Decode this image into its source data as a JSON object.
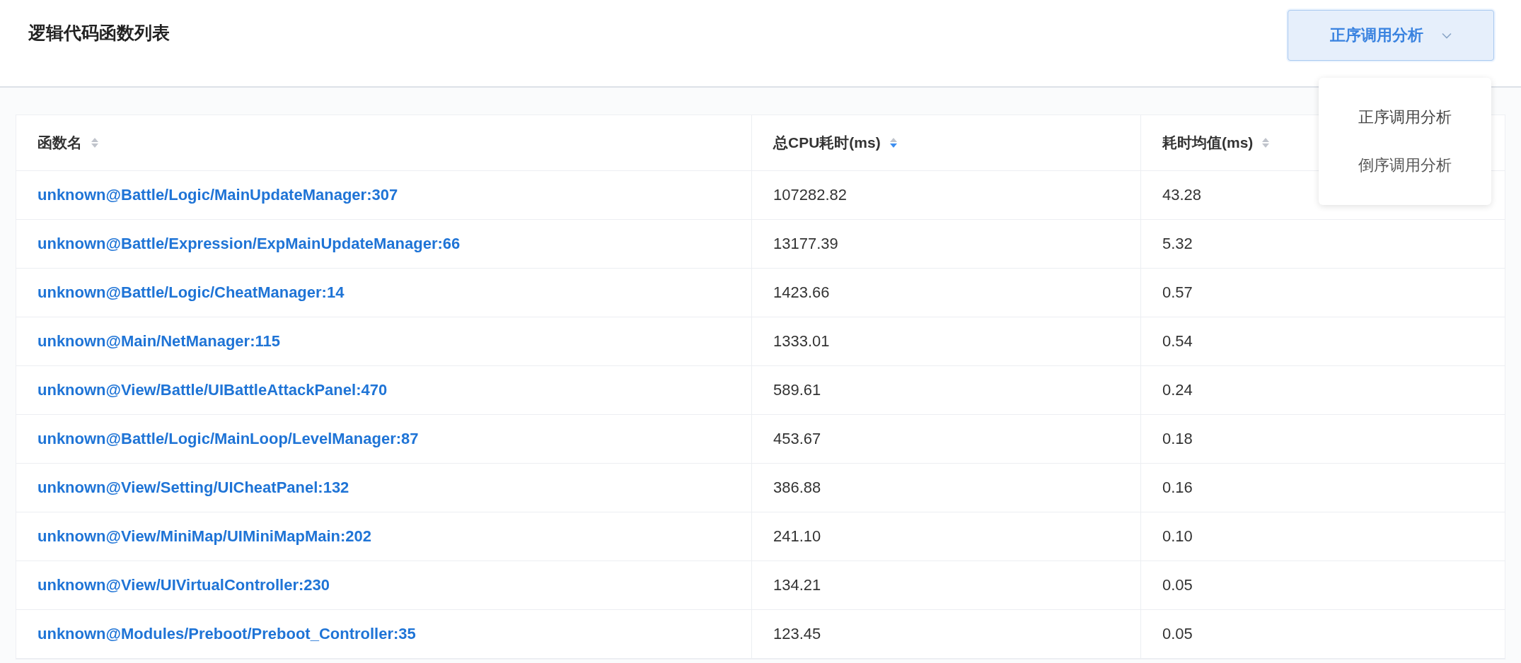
{
  "header": {
    "title": "逻辑代码函数列表",
    "dropdown": {
      "value": "正序调用分析",
      "expanded": true,
      "options": [
        {
          "label": "正序调用分析",
          "selected": true
        },
        {
          "label": "倒序调用分析",
          "selected": false
        }
      ]
    }
  },
  "table": {
    "columns": [
      {
        "label": "函数名",
        "sorted_descending": false
      },
      {
        "label": "总CPU耗时(ms)",
        "sorted_descending": true
      },
      {
        "label": "耗时均值(ms)",
        "sorted_descending": false
      }
    ],
    "rows": [
      [
        "unknown@Battle/Logic/MainUpdateManager:307",
        "107282.82",
        "43.28"
      ],
      [
        "unknown@Battle/Expression/ExpMainUpdateManager:66",
        "13177.39",
        "5.32"
      ],
      [
        "unknown@Battle/Logic/CheatManager:14",
        "1423.66",
        "0.57"
      ],
      [
        "unknown@Main/NetManager:115",
        "1333.01",
        "0.54"
      ],
      [
        "unknown@View/Battle/UIBattleAttackPanel:470",
        "589.61",
        "0.24"
      ],
      [
        "unknown@Battle/Logic/MainLoop/LevelManager:87",
        "453.67",
        "0.18"
      ],
      [
        "unknown@View/Setting/UICheatPanel:132",
        "386.88",
        "0.16"
      ],
      [
        "unknown@View/MiniMap/UIMiniMapMain:202",
        "241.10",
        "0.10"
      ],
      [
        "unknown@View/UIVirtualController:230",
        "134.21",
        "0.05"
      ],
      [
        "unknown@Modules/Preboot/Preboot_Controller:35",
        "123.45",
        "0.05"
      ]
    ]
  }
}
